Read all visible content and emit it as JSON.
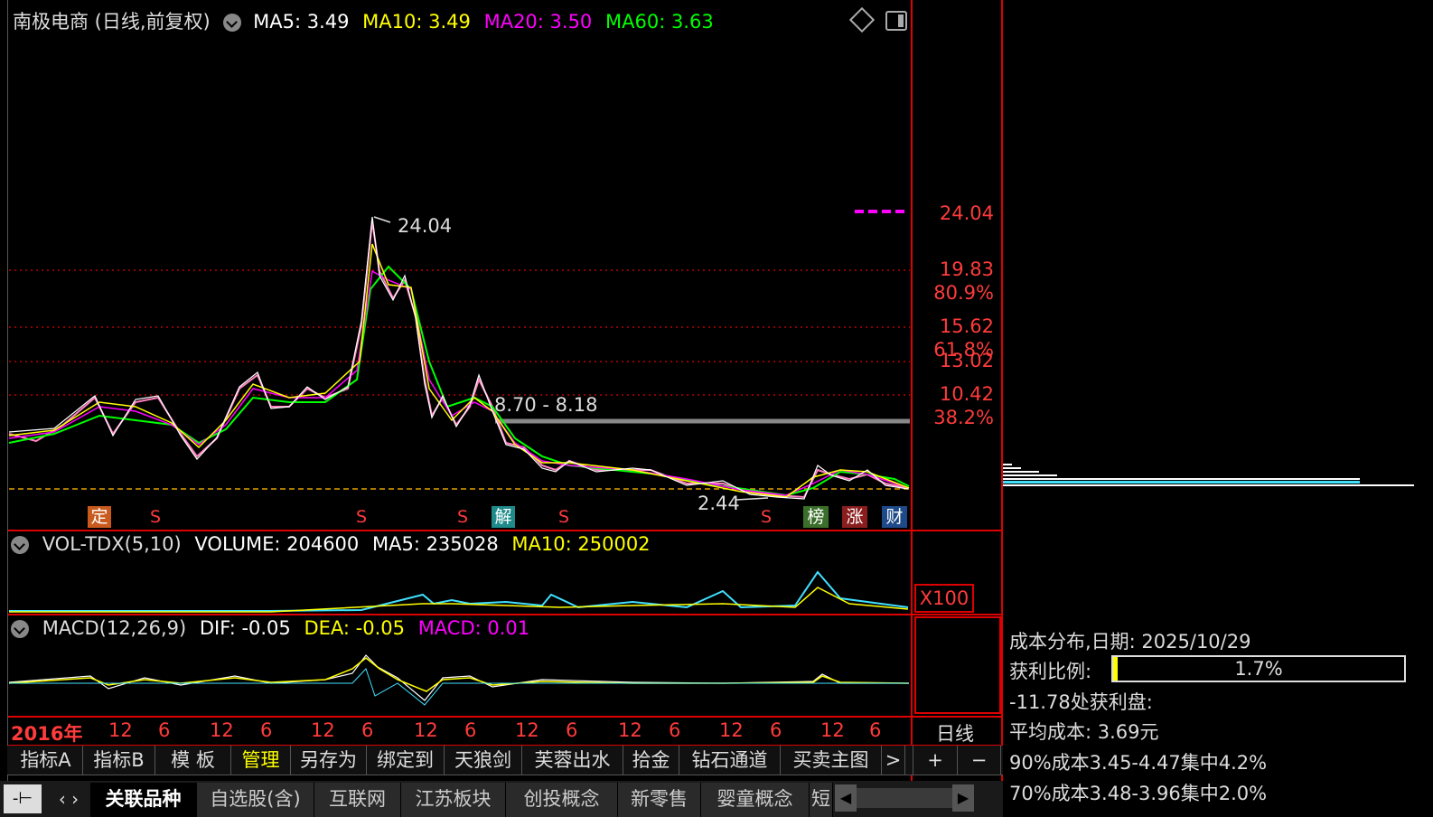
{
  "header": {
    "title": "南极电商 (日线,前复权)",
    "ma5_label": "MA5: 3.49",
    "ma10_label": "MA10: 3.49",
    "ma20_label": "MA20: 3.50",
    "ma60_label": "MA60: 3.63"
  },
  "price_axis": {
    "labels": [
      "24.04",
      "19.83",
      "80.9%",
      "15.62",
      "61.8%",
      "13.02",
      "10.42",
      "38.2%"
    ]
  },
  "annotations": {
    "high": "24.04",
    "low": "2.44",
    "range": "8.70 - 8.18"
  },
  "badges": [
    {
      "text": "定",
      "color": "#c85a1e"
    },
    {
      "text": "S",
      "color": "#ff3b3b"
    },
    {
      "text": "S",
      "color": "#ff3b3b"
    },
    {
      "text": "S",
      "color": "#ff3b3b"
    },
    {
      "text": "解",
      "color": "#1e8a8a"
    },
    {
      "text": "S",
      "color": "#ff3b3b"
    },
    {
      "text": "S",
      "color": "#ff3b3b"
    },
    {
      "text": "榜",
      "color": "#3a6e2a"
    },
    {
      "text": "涨",
      "color": "#8a1e1e"
    },
    {
      "text": "财",
      "color": "#1e4a8a"
    }
  ],
  "volume": {
    "name": "VOL-TDX(5,10)",
    "volume": "VOLUME: 204600",
    "ma5": "MA5: 235028",
    "ma10": "MA10: 250002",
    "unit": "X100"
  },
  "macd": {
    "name": "MACD(12,26,9)",
    "dif": "DIF: -0.05",
    "dea": "DEA: -0.05",
    "macd": "MACD: 0.01"
  },
  "time_axis": {
    "year": "2016年",
    "ticks": [
      "12",
      "6",
      "12",
      "6",
      "12",
      "6",
      "12",
      "6",
      "12",
      "6",
      "12",
      "6",
      "12",
      "6",
      "12",
      "6"
    ],
    "period": "日线"
  },
  "toolbar": {
    "items": [
      "指标A",
      "指标B",
      "模 板",
      "管理",
      "另存为",
      "绑定到",
      "天狼剑",
      "芙蓉出水",
      "拾金",
      "钻石通道",
      "买卖主图"
    ],
    "more": ">",
    "plus": "+",
    "minus": "−"
  },
  "tabs": {
    "items": [
      "关联品种",
      "自选股(含)",
      "互联网",
      "江苏板块",
      "创投概念",
      "新零售",
      "婴童概念",
      "短"
    ]
  },
  "cost_panel": {
    "title": "成本分布,日期: 2025/10/29",
    "profit_label": "获利比例:",
    "profit_value": "1.7%",
    "profit_fraction": 0.017,
    "line1": "-11.78处获利盘:",
    "avg": "平均成本: 3.69元",
    "c90": "90%成本3.45-4.47集中4.2%",
    "c70": "70%成本3.48-3.96集中2.0%"
  },
  "colors": {
    "ma5": "#ffffff",
    "ma10": "#ffff00",
    "ma20": "#ff00ff",
    "ma60": "#00ff00",
    "axis_red": "#ff3b3b"
  }
}
